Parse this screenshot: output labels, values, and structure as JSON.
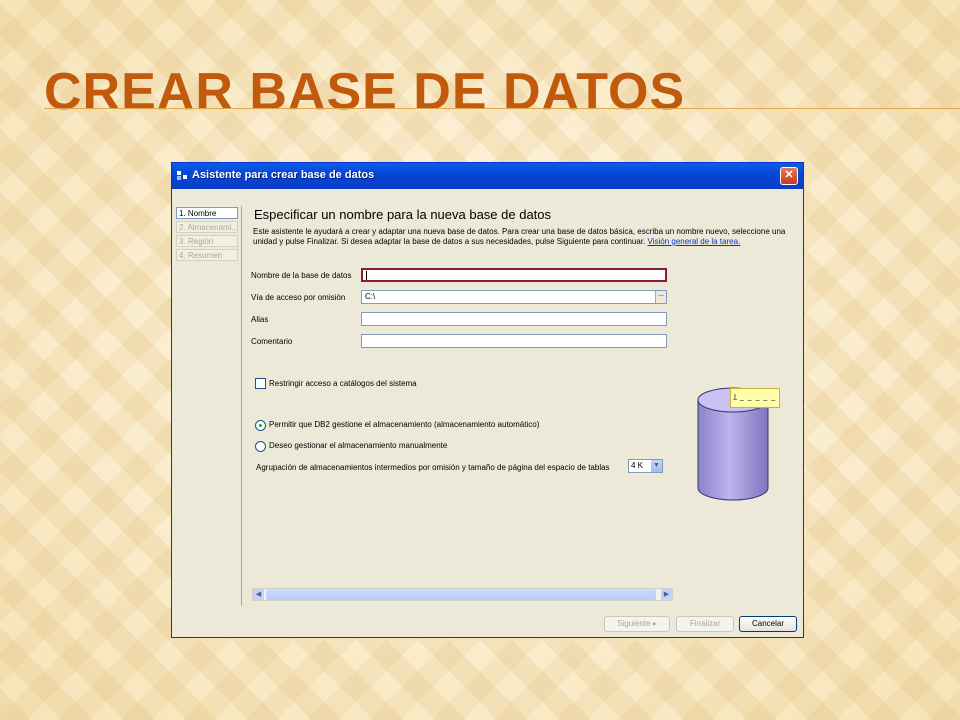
{
  "slide": {
    "title": "Crear base de datos"
  },
  "window": {
    "title": "Asistente para crear base de datos",
    "close_glyph": "✕"
  },
  "sidebar": {
    "items": [
      {
        "label": "1. Nombre",
        "active": true
      },
      {
        "label": "2. Almacenami...",
        "active": false
      },
      {
        "label": "3. Región",
        "active": false
      },
      {
        "label": "4. Resumen",
        "active": false
      }
    ]
  },
  "content": {
    "heading": "Especificar un nombre para la nueva base de datos",
    "intro_text": "Este asistente le ayudará a crear y adaptar una nueva base de datos. Para crear una base de datos básica, escriba un nombre nuevo, seleccione una unidad y pulse Finalizar. Si desea adaptar la base de datos a sus necesidades, pulse Siguiente para continuar.",
    "intro_link": "Visión general de la tarea.",
    "fields": {
      "name_label": "Nombre de la base de datos",
      "name_value": "",
      "path_label": "Vía de acceso por omisión",
      "path_value": "C:\\",
      "alias_label": "Alias",
      "alias_value": "",
      "comment_label": "Comentario",
      "comment_value": "",
      "browse_glyph": "..."
    },
    "restrict_checkbox": {
      "label": "Restringir acceso a catálogos del sistema",
      "checked": false
    },
    "storage_options": [
      {
        "label": "Permitir que DB2 gestione el almacenamiento (almacenamiento automático)",
        "selected": true
      },
      {
        "label": "Deseo gestionar el almacenamiento manualmente",
        "selected": false
      }
    ],
    "bufferpool": {
      "label": "Agrupación de almacenamientos intermedios por omisión y tamaño de página del espacio de tablas",
      "value": "4 K"
    },
    "tooltip_text": "I̲ _ _ _ _ _"
  },
  "buttons": {
    "next": "Siguiente ▸",
    "finish": "Finalizar",
    "cancel": "Cancelar"
  },
  "colors": {
    "title": "#c15a0c",
    "titlebar": "#0447d6",
    "link": "#0033cc",
    "focus_border": "#8c1b36"
  }
}
